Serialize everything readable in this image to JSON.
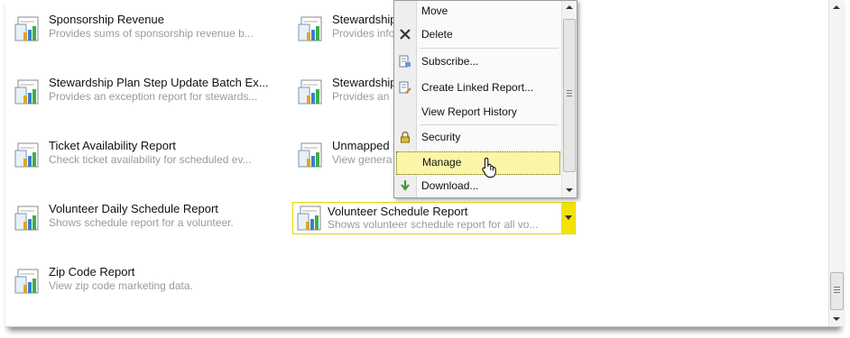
{
  "reports": [
    {
      "title": "Sponsorship Revenue",
      "desc": "Provides sums of sponsorship revenue b..."
    },
    {
      "title": "Stewardship",
      "desc": "Provides info"
    },
    {
      "title": "Stewardship Plan Step Update Batch Ex...",
      "desc": "Provides an exception report for stewards..."
    },
    {
      "title": "Stewardship",
      "desc": "Provides an"
    },
    {
      "title": "Ticket Availability Report",
      "desc": "Check ticket availability for scheduled ev..."
    },
    {
      "title": "Unmapped G",
      "desc": "View genera"
    },
    {
      "title": "Volunteer Daily Schedule Report",
      "desc": "Shows schedule report for a volunteer."
    },
    {
      "title": "Volunteer Schedule Report",
      "desc": "Shows volunteer schedule report for all vo..."
    },
    {
      "title": "Zip Code Report",
      "desc": "View zip code marketing data."
    }
  ],
  "menu": {
    "items": [
      {
        "label": "Move",
        "icon": ""
      },
      {
        "label": "Delete",
        "icon": "delete-x-icon"
      },
      {
        "label": "Subscribe...",
        "icon": "subscribe-icon"
      },
      {
        "label": "Create Linked Report...",
        "icon": "linked-report-icon"
      },
      {
        "label": "View Report History",
        "icon": ""
      },
      {
        "label": "Security",
        "icon": "lock-icon"
      },
      {
        "label": "Manage",
        "icon": ""
      },
      {
        "label": "Download...",
        "icon": "download-arrow-icon"
      }
    ],
    "highlighted": "Manage"
  },
  "colors": {
    "selection": "#f3e300",
    "highlight": "#fbf5a8",
    "desc_text": "#9a9a9a"
  }
}
